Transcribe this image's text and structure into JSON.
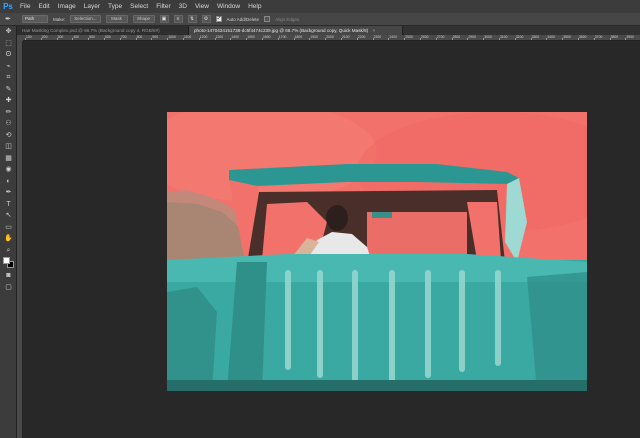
{
  "app": {
    "logo": "Ps",
    "accent": "#31a8ff"
  },
  "menu": [
    "File",
    "Edit",
    "Image",
    "Layer",
    "Type",
    "Select",
    "Filter",
    "3D",
    "View",
    "Window",
    "Help"
  ],
  "options": {
    "tool_icon": "pen-icon",
    "mode_value": "Path",
    "make_label": "Make:",
    "selection_btn": "Selection...",
    "mask_btn": "Mask",
    "shape_btn": "Shape",
    "auto_add_delete": "Auto Add/Delete",
    "auto_add_delete_checked": true,
    "align_edges": "Align Edges",
    "align_edges_checked": false
  },
  "tabs": [
    {
      "label": "Hair Masking Complex.psd @ 66.7% (Background copy 4, RGB/8#)",
      "active": false,
      "close": "×"
    },
    {
      "label": "photo-1470434151738-dc5f4474c239.jpg @ 66.7% (Background copy, Quick Mask/8)",
      "active": true,
      "close": "×"
    }
  ],
  "ruler": {
    "start": 100,
    "step": 100,
    "labels": [
      "100",
      "200",
      "300",
      "400",
      "500",
      "600",
      "700",
      "800",
      "900",
      "1000",
      "1100",
      "1200",
      "1300",
      "1400",
      "1500",
      "1600",
      "1700",
      "1800",
      "1900",
      "2000",
      "2100",
      "2200",
      "2300",
      "2400",
      "2500",
      "2600",
      "2700",
      "2800",
      "2900",
      "3000",
      "3100",
      "3200",
      "3300",
      "3400",
      "3500",
      "3600",
      "3700",
      "3800",
      "3900"
    ]
  },
  "tools": [
    "move-icon",
    "marquee-icon",
    "lasso-icon",
    "quick-select-icon",
    "crop-icon",
    "eyedropper-icon",
    "healing-icon",
    "brush-icon",
    "stamp-icon",
    "history-brush-icon",
    "eraser-icon",
    "gradient-icon",
    "blur-icon",
    "dodge-icon",
    "pen-icon",
    "type-icon",
    "path-select-icon",
    "shape-icon",
    "hand-icon",
    "zoom-icon"
  ],
  "tool_glyphs": [
    "✥",
    "⬚",
    "ʘ",
    "⌁",
    "⌗",
    "✎",
    "✚",
    "✏",
    "⚇",
    "⟲",
    "◫",
    "▦",
    "◉",
    "◐",
    "✒",
    "T",
    "↖",
    "▭",
    "✋",
    "⌕"
  ],
  "colors": {
    "foreground": "#ffffff",
    "background": "#000000",
    "quickmask_overlay": "#f2716a",
    "car_teal": "#3aa9a2"
  }
}
